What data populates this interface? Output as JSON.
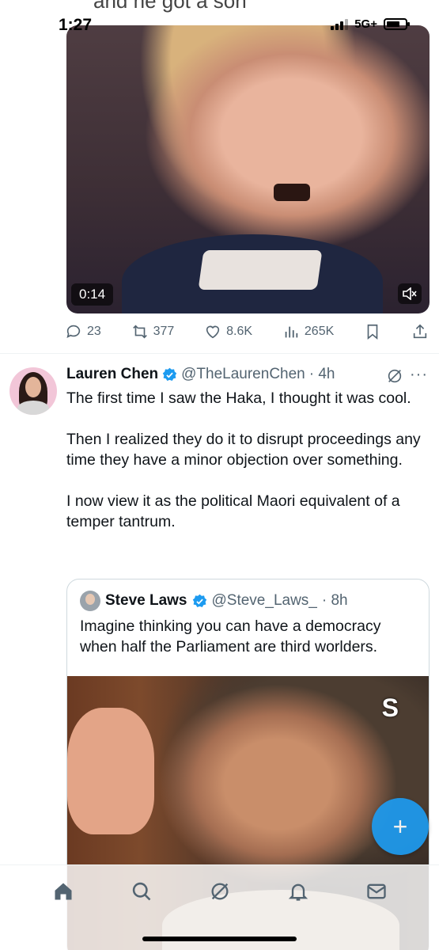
{
  "status_bar": {
    "time": "1:27",
    "network": "5G+"
  },
  "previous_tweet": {
    "partial_text": "and he got a son",
    "video": {
      "duration": "0:14",
      "muted": true
    },
    "actions": {
      "replies": "23",
      "reposts": "377",
      "likes": "8.6K",
      "views": "265K"
    }
  },
  "tweet": {
    "author_name": "Lauren Chen",
    "handle": "@TheLaurenChen",
    "time": "· 4h",
    "verified": true,
    "paragraphs": [
      "The first time I saw the Haka, I thought it was cool.",
      "Then I realized they do it to disrupt proceedings any time they have a minor objection over something.",
      "I now view it as the political Maori equivalent of a temper tantrum."
    ],
    "quote": {
      "author_name": "Steve Laws",
      "handle": "@Steve_Laws_",
      "time": "· 8h",
      "verified": true,
      "text": "Imagine thinking you can have a democracy when half the Parliament are third worlders.",
      "image_watermark": "S"
    }
  },
  "fab": {
    "label": "+"
  },
  "bottom_nav": {
    "items": [
      "home-icon",
      "search-icon",
      "grok-icon",
      "notifications-icon",
      "messages-icon"
    ]
  },
  "colors": {
    "accent": "#1d9bf0",
    "secondary_text": "#536471",
    "primary_text": "#0f1419"
  }
}
